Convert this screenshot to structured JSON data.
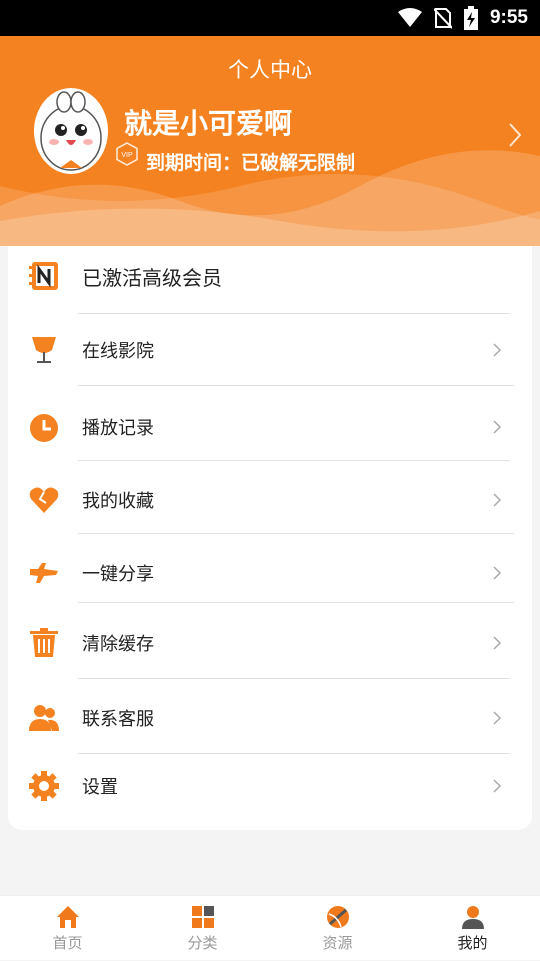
{
  "status_bar": {
    "time": "9:55",
    "icons": [
      "wifi-icon",
      "no-sim-icon",
      "battery-charging-icon"
    ]
  },
  "header": {
    "title": "个人中心",
    "username": "就是小可爱啊",
    "vip_badge": "VIP",
    "expire_text": "到期时间：已破解无限制",
    "background_color": "#f58220"
  },
  "menu": {
    "items": [
      {
        "label": "已激活高级会员",
        "icon": "n-badge-icon"
      },
      {
        "label": "在线影院",
        "icon": "trophy-cup-icon"
      },
      {
        "label": "播放记录",
        "icon": "clock-icon"
      },
      {
        "label": "我的收藏",
        "icon": "heart-icon"
      },
      {
        "label": "一键分享",
        "icon": "share-icon"
      },
      {
        "label": "清除缓存",
        "icon": "trash-icon"
      },
      {
        "label": "联系客服",
        "icon": "users-icon"
      },
      {
        "label": "设置",
        "icon": "settings-gear-icon"
      }
    ]
  },
  "tabbar": {
    "active_color": "#f07a1b",
    "tabs": [
      {
        "label": "首页",
        "icon": "home-icon"
      },
      {
        "label": "分类",
        "icon": "grid-icon"
      },
      {
        "label": "资源",
        "icon": "ball-icon"
      },
      {
        "label": "我的",
        "icon": "person-icon",
        "active": true
      }
    ]
  }
}
